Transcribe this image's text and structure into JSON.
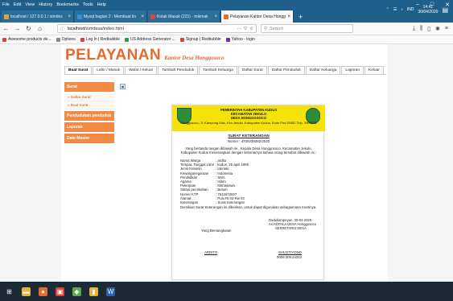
{
  "menu": [
    "File",
    "Edit",
    "View",
    "History",
    "Bookmarks",
    "Tools",
    "Help"
  ],
  "window_controls": {
    "minimize": "–",
    "maximize": "□",
    "close": "✕"
  },
  "tabs": [
    {
      "title": "localhost / 127.0.0.1 / simdes",
      "color": "#e8a23a",
      "active": false
    },
    {
      "title": "Mysql bagian 2 : Membuat lin",
      "color": "#3a8fd9",
      "active": false
    },
    {
      "title": "Kotak Masuk (221) - mikmak",
      "color": "#d9453a",
      "active": false
    },
    {
      "title": "Pelayanan Kantor Desa Hongg",
      "color": "#e86d2c",
      "active": true
    }
  ],
  "nav": {
    "url_prefix": "localhost",
    "url_rest": "/simdesa/index.html",
    "url_display": "localhost/simdesa/index.html",
    "ellipsis": "···",
    "search_placeholder": "Search"
  },
  "bookmarks": [
    {
      "label": "Awesome products de...",
      "color": "#d9453a"
    },
    {
      "label": "Options",
      "color": "#888888"
    },
    {
      "label": "Log In | Redbubble",
      "color": "#d9453a"
    },
    {
      "label": "US Address Generator ...",
      "color": "#2e9c4a"
    },
    {
      "label": "Signup | Redbubble",
      "color": "#d9453a"
    },
    {
      "label": "Yahoo - login",
      "color": "#6b2fb3"
    }
  ],
  "site": {
    "brand": "PELAYANAN",
    "brand_sub": "Kantor Desa Honggosoco",
    "menu": [
      "Buat Surat",
      "Lahir / Masuk",
      "Wafat / Keluar",
      "Tambah Penduduk",
      "Tambah Keluarga",
      "Daftar Surat",
      "Daftar Penduduk",
      "Daftar Keluarga",
      "Laporan",
      "Keluar"
    ],
    "active_menu": "Buat Surat",
    "sidebar": {
      "surat": "Surat",
      "surat_items": [
        "» Daftar Surat",
        "» Buat Surat"
      ],
      "penduduk": "Pendudukan penduduk",
      "laporan": "Laporan",
      "master": "Data Master"
    }
  },
  "document": {
    "kop": [
      "PEMERINTAH KABUPATEN KUDUS",
      "KECAMATAN JEKULO",
      "DESA HONGGOSOCO"
    ],
    "kop_address": "Honggosoco, Jl. Kampung Mas, Kec.Jekulo, Kabupaten Kudus, Kode Pos 59382 Telp. 3903232",
    "title": "SURAT KETERANGAN",
    "nomor": "Nomer : 470/5/39382/2020",
    "para": "Yang bertanda tangan dibawah ini , Kepala Desa Honggosoco, Kecamatan Jekulo, Kabupaten Kudus menerangkan dengan sebenarnya bahwa orang tersebut dibawah ini :",
    "fields": [
      {
        "k": "Nama Warga",
        "v": ": ardito"
      },
      {
        "k": "Tempat, Tanggal Lahir",
        "v": ": kudus, 25 april 1990"
      },
      {
        "k": "Jenis Kelamin",
        "v": ": laki laki"
      },
      {
        "k": "Kewarganegaraan",
        "v": ": Indonesia"
      },
      {
        "k": "Pendidikan",
        "v": ": SMA"
      },
      {
        "k": "Agama",
        "v": ": Islam"
      },
      {
        "k": "Pekerjaan",
        "v": ": Mahasiswa"
      },
      {
        "k": "Status pernikahan",
        "v": ": Belum"
      },
      {
        "k": "Nomer KTP",
        "v": ": 7612672827"
      },
      {
        "k": "Alamat",
        "v": ": Pulo Rt 03 Rw 03"
      },
      {
        "k": "Keterangan",
        "v": ": Surat Keterangan"
      }
    ],
    "closing": "Demikian Surat Keterangan ini diberikan, untuk dapat digunakan sebagaimana mestinya.",
    "sign_place_date": "Dudukampeyan, 30-04-2020",
    "sign_title1": "An.KEPALA DESA Honggosoco",
    "sign_title2": "SEKRETARIS DESA",
    "yang_bersangkutan": "Yang Bersangkutan",
    "name_left": "ARDITO",
    "name_right": "SULISTIYONO",
    "nip": "0009.009.34343"
  },
  "taskbar": {
    "apps": [
      {
        "name": "windows",
        "glyph": "⊞",
        "color": "#1c2a36"
      },
      {
        "name": "files",
        "glyph": "▬",
        "color": "#e8b33a"
      },
      {
        "name": "firefox",
        "glyph": "●",
        "color": "#e8692c"
      },
      {
        "name": "app-red",
        "glyph": "▣",
        "color": "#d9453a"
      },
      {
        "name": "app-green",
        "glyph": "◆",
        "color": "#5aa84a"
      },
      {
        "name": "app-yellow",
        "glyph": "▮",
        "color": "#e8b33a"
      },
      {
        "name": "word",
        "glyph": "W",
        "color": "#2b5fb3"
      }
    ],
    "lang": "IND",
    "time": "14:41",
    "date": "30/04/2020"
  }
}
